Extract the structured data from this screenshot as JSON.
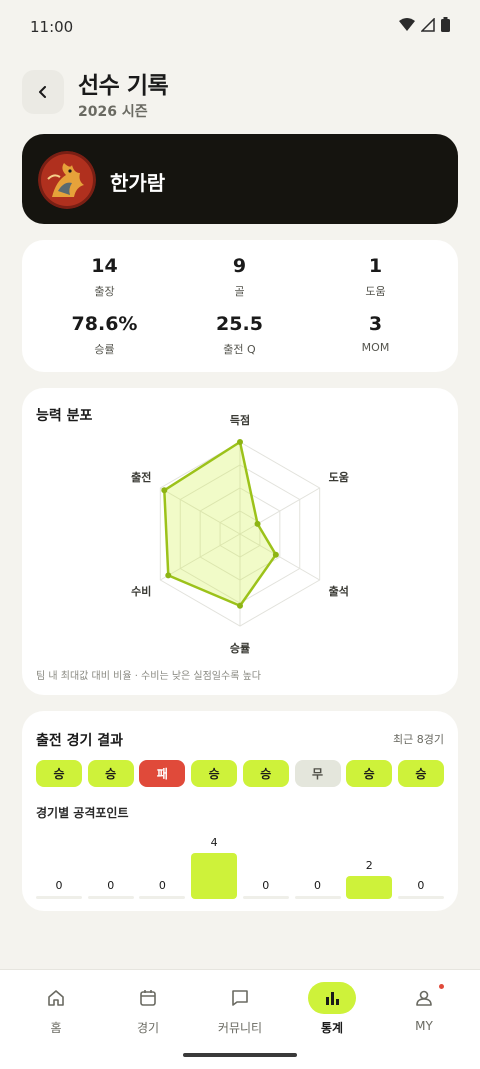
{
  "status_bar": {
    "time": "11:00"
  },
  "header": {
    "title": "선수 기록",
    "subtitle": "2026 시즌"
  },
  "profile": {
    "name": "한가람"
  },
  "stats": [
    {
      "value": "14",
      "label": "출장"
    },
    {
      "value": "9",
      "label": "골"
    },
    {
      "value": "1",
      "label": "도움"
    },
    {
      "value": "78.6%",
      "label": "승률"
    },
    {
      "value": "25.5",
      "label": "출전 Q"
    },
    {
      "value": "3",
      "label": "MOM"
    }
  ],
  "radar": {
    "title": "능력 분포",
    "axes": [
      "득점",
      "도움",
      "출석",
      "승률",
      "수비",
      "출전"
    ],
    "values": [
      1.0,
      0.22,
      0.45,
      0.78,
      0.9,
      0.95
    ],
    "note": "팀 내 최대값 대비 비율 · 수비는 낮은 실점일수록 높다"
  },
  "results": {
    "title": "출전 경기 결과",
    "recent": "최근 8경기",
    "games": [
      {
        "label": "승",
        "type": "win"
      },
      {
        "label": "승",
        "type": "win"
      },
      {
        "label": "패",
        "type": "loss"
      },
      {
        "label": "승",
        "type": "win"
      },
      {
        "label": "승",
        "type": "win"
      },
      {
        "label": "무",
        "type": "draw"
      },
      {
        "label": "승",
        "type": "win"
      },
      {
        "label": "승",
        "type": "win"
      }
    ],
    "points_title": "경기별 공격포인트",
    "points": [
      "0",
      "0",
      "0",
      "4",
      "0",
      "0",
      "2",
      "0"
    ]
  },
  "nav": [
    {
      "label": "홈",
      "icon": "home-icon"
    },
    {
      "label": "경기",
      "icon": "calendar-icon"
    },
    {
      "label": "커뮤니티",
      "icon": "chat-icon"
    },
    {
      "label": "통계",
      "icon": "bar-chart-icon"
    },
    {
      "label": "MY",
      "icon": "person-icon"
    }
  ],
  "colors": {
    "accent": "#cef23a",
    "loss": "#e04a3a",
    "dark": "#15140f",
    "background": "#f4f3ee"
  }
}
